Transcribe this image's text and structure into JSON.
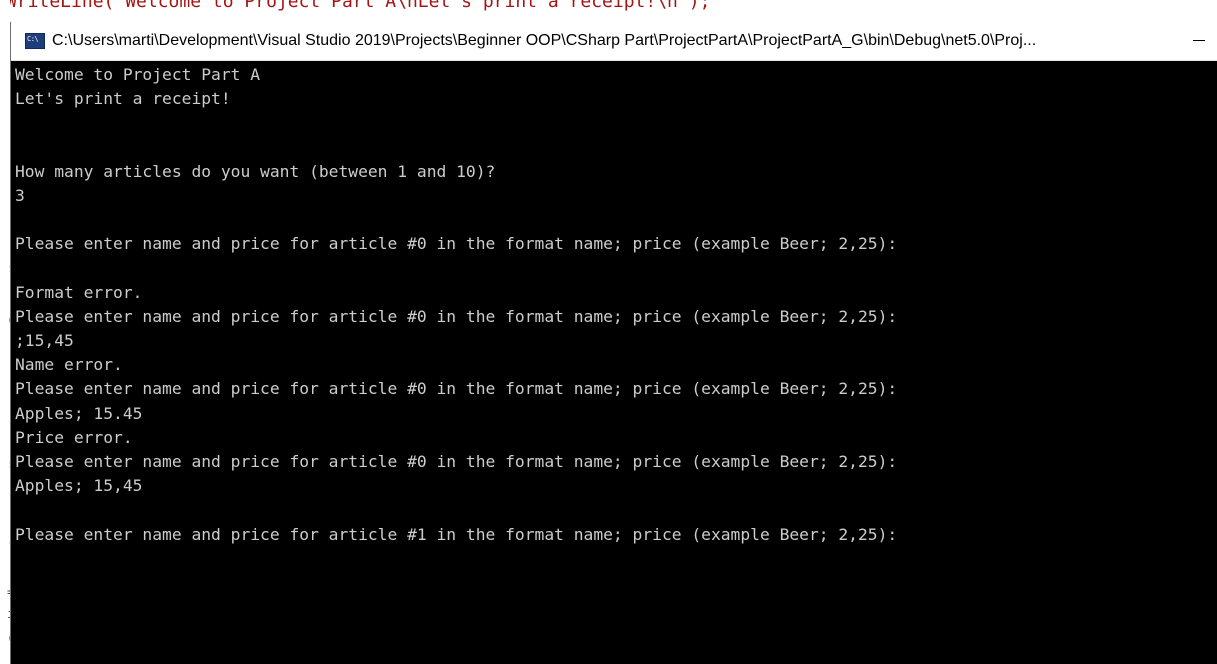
{
  "editor": {
    "code_fragment": "WriteLine( Welcome to Project Part A\\nLet's print a receipt!\\n );"
  },
  "window": {
    "title": "C:\\Users\\marti\\Development\\Visual Studio 2019\\Projects\\Beginner OOP\\CSharp Part\\ProjectPartA\\ProjectPartA_G\\bin\\Debug\\net5.0\\Proj...",
    "icon": "console-icon",
    "minimize_icon": "minimize-icon"
  },
  "console": {
    "background": "#000000",
    "foreground": "#cccccc",
    "lines": [
      "Welcome to Project Part A",
      "Let's print a receipt!",
      "",
      "",
      "How many articles do you want (between 1 and 10)?",
      "3",
      "",
      "Please enter name and price for article #0 in the format name; price (example Beer; 2,25):",
      "",
      "Format error.",
      "Please enter name and price for article #0 in the format name; price (example Beer; 2,25):",
      ";15,45",
      "Name error.",
      "Please enter name and price for article #0 in the format name; price (example Beer; 2,25):",
      "Apples; 15.45",
      "Price error.",
      "Please enter name and price for article #0 in the format name; price (example Beer; 2,25):",
      "Apples; 15,45",
      "",
      "Please enter name and price for article #1 in the format name; price (example Beer; 2,25):"
    ]
  }
}
